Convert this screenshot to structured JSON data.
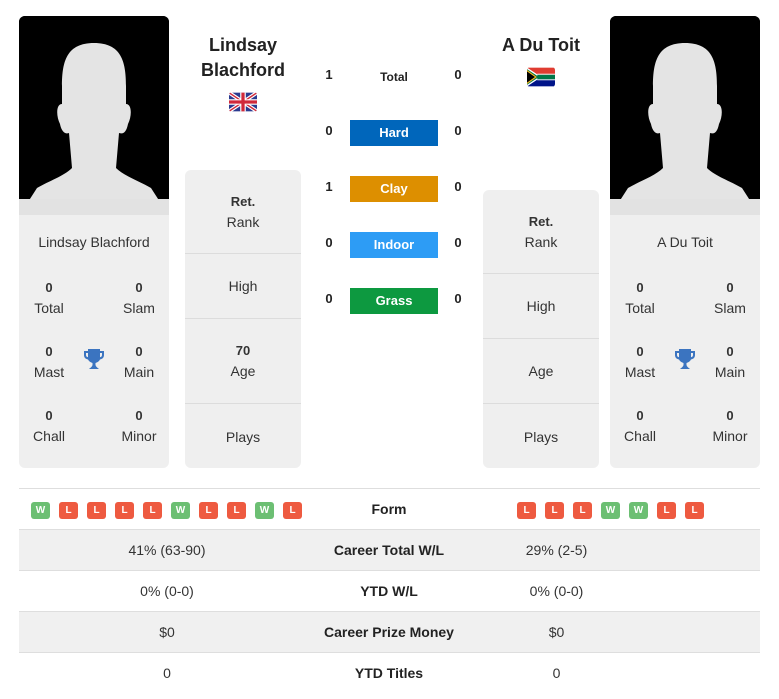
{
  "player1": {
    "name": "Lindsay Blachford",
    "header_line1": "Lindsay",
    "header_line2": "Blachford",
    "flag": "uk-flag",
    "titles": {
      "total": "0",
      "total_label": "Total",
      "slam": "0",
      "slam_label": "Slam",
      "mast": "0",
      "mast_label": "Mast",
      "main": "0",
      "main_label": "Main",
      "chall": "0",
      "chall_label": "Chall",
      "minor": "0",
      "minor_label": "Minor"
    },
    "rank": {
      "value": "Ret.",
      "label": "Rank"
    },
    "high": {
      "value": "",
      "label": "High"
    },
    "age": {
      "value": "70",
      "label": "Age"
    },
    "plays": {
      "value": "",
      "label": "Plays"
    },
    "form": [
      "W",
      "L",
      "L",
      "L",
      "L",
      "W",
      "L",
      "L",
      "W",
      "L"
    ],
    "career_wl": "41% (63-90)",
    "ytd_wl": "0% (0-0)",
    "prize_money": "$0",
    "ytd_titles": "0"
  },
  "player2": {
    "name": "A Du Toit",
    "header_line1": "A Du Toit",
    "flag": "south-africa-flag",
    "titles": {
      "total": "0",
      "total_label": "Total",
      "slam": "0",
      "slam_label": "Slam",
      "mast": "0",
      "mast_label": "Mast",
      "main": "0",
      "main_label": "Main",
      "chall": "0",
      "chall_label": "Chall",
      "minor": "0",
      "minor_label": "Minor"
    },
    "rank": {
      "value": "Ret.",
      "label": "Rank"
    },
    "high": {
      "value": "",
      "label": "High"
    },
    "age": {
      "value": "",
      "label": "Age"
    },
    "plays": {
      "value": "",
      "label": "Plays"
    },
    "form": [
      "L",
      "L",
      "L",
      "W",
      "W",
      "L",
      "L"
    ],
    "career_wl": "29% (2-5)",
    "ytd_wl": "0% (0-0)",
    "prize_money": "$0",
    "ytd_titles": "0"
  },
  "h2h": [
    {
      "label": "Total",
      "p1": "1",
      "p2": "0",
      "color": ""
    },
    {
      "label": "Hard",
      "p1": "0",
      "p2": "0",
      "color": "#0066bb"
    },
    {
      "label": "Clay",
      "p1": "1",
      "p2": "0",
      "color": "#dd8f00"
    },
    {
      "label": "Indoor",
      "p1": "0",
      "p2": "0",
      "color": "#2d9cf5"
    },
    {
      "label": "Grass",
      "p1": "0",
      "p2": "0",
      "color": "#0d9940"
    }
  ],
  "table": {
    "form_label": "Form",
    "career_wl_label": "Career Total W/L",
    "ytd_wl_label": "YTD W/L",
    "prize_label": "Career Prize Money",
    "ytd_titles_label": "YTD Titles"
  },
  "colors": {
    "win": "#6cbf73",
    "loss": "#ee5a40",
    "trophy": "#3b74c0"
  }
}
